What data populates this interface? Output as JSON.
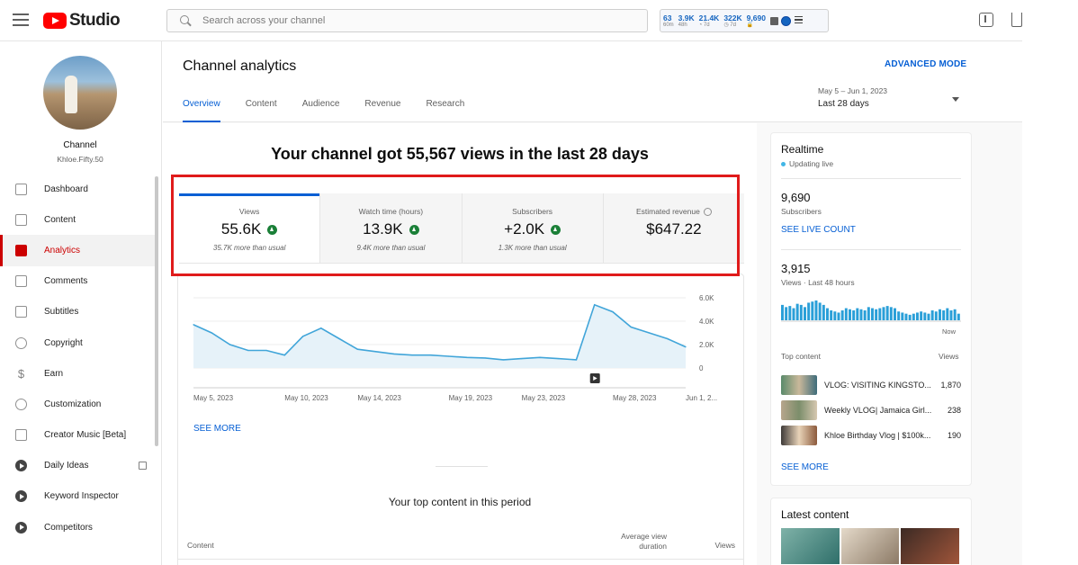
{
  "app": {
    "logo_text": "Studio",
    "search_placeholder": "Search across your channel"
  },
  "stats_widget": [
    {
      "value": "63",
      "label": "60m"
    },
    {
      "value": "3.9K",
      "label": "48h"
    },
    {
      "value": "21.4K",
      "label": "◔ 7d"
    },
    {
      "value": "322K",
      "label": "◷ 7d"
    },
    {
      "value": "9,690",
      "label": "🔒"
    }
  ],
  "sidebar": {
    "channel_label": "Channel",
    "channel_handle": "Khloe.Fifty.50",
    "items": [
      {
        "label": "Dashboard",
        "icon": "dashboard-icon"
      },
      {
        "label": "Content",
        "icon": "content-icon"
      },
      {
        "label": "Analytics",
        "icon": "analytics-icon",
        "active": true
      },
      {
        "label": "Comments",
        "icon": "comments-icon"
      },
      {
        "label": "Subtitles",
        "icon": "subtitles-icon"
      },
      {
        "label": "Copyright",
        "icon": "copyright-icon"
      },
      {
        "label": "Earn",
        "icon": "dollar-icon"
      },
      {
        "label": "Customization",
        "icon": "customization-icon"
      },
      {
        "label": "Creator Music [Beta]",
        "icon": "music-icon"
      },
      {
        "label": "Daily Ideas",
        "icon": "vidiq-icon"
      },
      {
        "label": "Keyword Inspector",
        "icon": "vidiq-icon"
      },
      {
        "label": "Competitors",
        "icon": "vidiq-icon"
      }
    ]
  },
  "header": {
    "title": "Channel analytics",
    "advanced_mode": "ADVANCED MODE",
    "tabs": [
      "Overview",
      "Content",
      "Audience",
      "Revenue",
      "Research"
    ],
    "active_tab": "Overview",
    "date_range": "May 5 – Jun 1, 2023",
    "period": "Last 28 days"
  },
  "overview": {
    "headline": "Your channel got 55,567 views in the last 28 days",
    "metrics": [
      {
        "label": "Views",
        "value": "55.6K",
        "sub": "35.7K more than usual",
        "trend": "up"
      },
      {
        "label": "Watch time (hours)",
        "value": "13.9K",
        "sub": "9.4K more than usual",
        "trend": "up"
      },
      {
        "label": "Subscribers",
        "value": "+2.0K",
        "sub": "1.3K more than usual",
        "trend": "up"
      },
      {
        "label": "Estimated revenue",
        "value": "$647.22",
        "sub": "",
        "trend": "none"
      }
    ],
    "see_more": "SEE MORE",
    "top_content_title": "Your top content in this period",
    "table_headers": {
      "content": "Content",
      "avd": "Average view duration",
      "views": "Views"
    }
  },
  "chart_data": {
    "type": "area",
    "series": [
      {
        "values": [
          3700,
          3000,
          2000,
          1500,
          1500,
          1100,
          2700,
          3400,
          2500,
          1600,
          1400,
          1200,
          1100,
          1100,
          1000,
          900,
          850,
          700,
          800,
          900,
          800,
          700,
          5400,
          4800,
          3500,
          3000,
          2500,
          1800
        ]
      }
    ],
    "x_tick_labels": [
      "May 5, 2023",
      "May 10, 2023",
      "May 14, 2023",
      "May 19, 2023",
      "May 23, 2023",
      "May 28, 2023",
      "Jun 1, 2..."
    ],
    "x_tick_index": [
      0,
      5,
      9,
      14,
      18,
      23,
      27
    ],
    "y_ticks": [
      "6.0K",
      "4.0K",
      "2.0K",
      "0"
    ],
    "y_tick_values": [
      6000,
      4000,
      2000,
      0
    ],
    "ylim": [
      0,
      6000
    ],
    "video_marker_index": 22,
    "grid": true
  },
  "realtime": {
    "title": "Realtime",
    "status": "Updating live",
    "subs_value": "9,690",
    "subs_label": "Subscribers",
    "live_count": "SEE LIVE COUNT",
    "views_value": "3,915",
    "views_label": "Views · Last 48 hours",
    "now_label": "Now",
    "hourly_views": [
      70,
      60,
      65,
      55,
      75,
      70,
      60,
      80,
      85,
      90,
      80,
      70,
      55,
      45,
      40,
      35,
      45,
      55,
      50,
      45,
      55,
      50,
      45,
      60,
      55,
      50,
      55,
      60,
      65,
      60,
      55,
      40,
      35,
      30,
      25,
      30,
      35,
      40,
      35,
      30,
      45,
      40,
      50,
      45,
      55,
      45,
      50,
      30
    ],
    "top_content_label": "Top content",
    "views_col": "Views",
    "top_content": [
      {
        "title": "VLOG: VISITING KINGSTO...",
        "views": "1,870"
      },
      {
        "title": "Weekly VLOG| Jamaica Girl...",
        "views": "238"
      },
      {
        "title": "Khloe Birthday Vlog | $100k...",
        "views": "190"
      }
    ],
    "see_more": "SEE MORE"
  },
  "latest": {
    "title": "Latest content"
  },
  "colors": {
    "accent_blue": "#065fd4",
    "active_red": "#cc0000",
    "highlight_red": "#e01b1b",
    "chart_line": "#41a5d9",
    "chart_fill": "#e6f2f9",
    "trend_green": "#1a7f37"
  }
}
